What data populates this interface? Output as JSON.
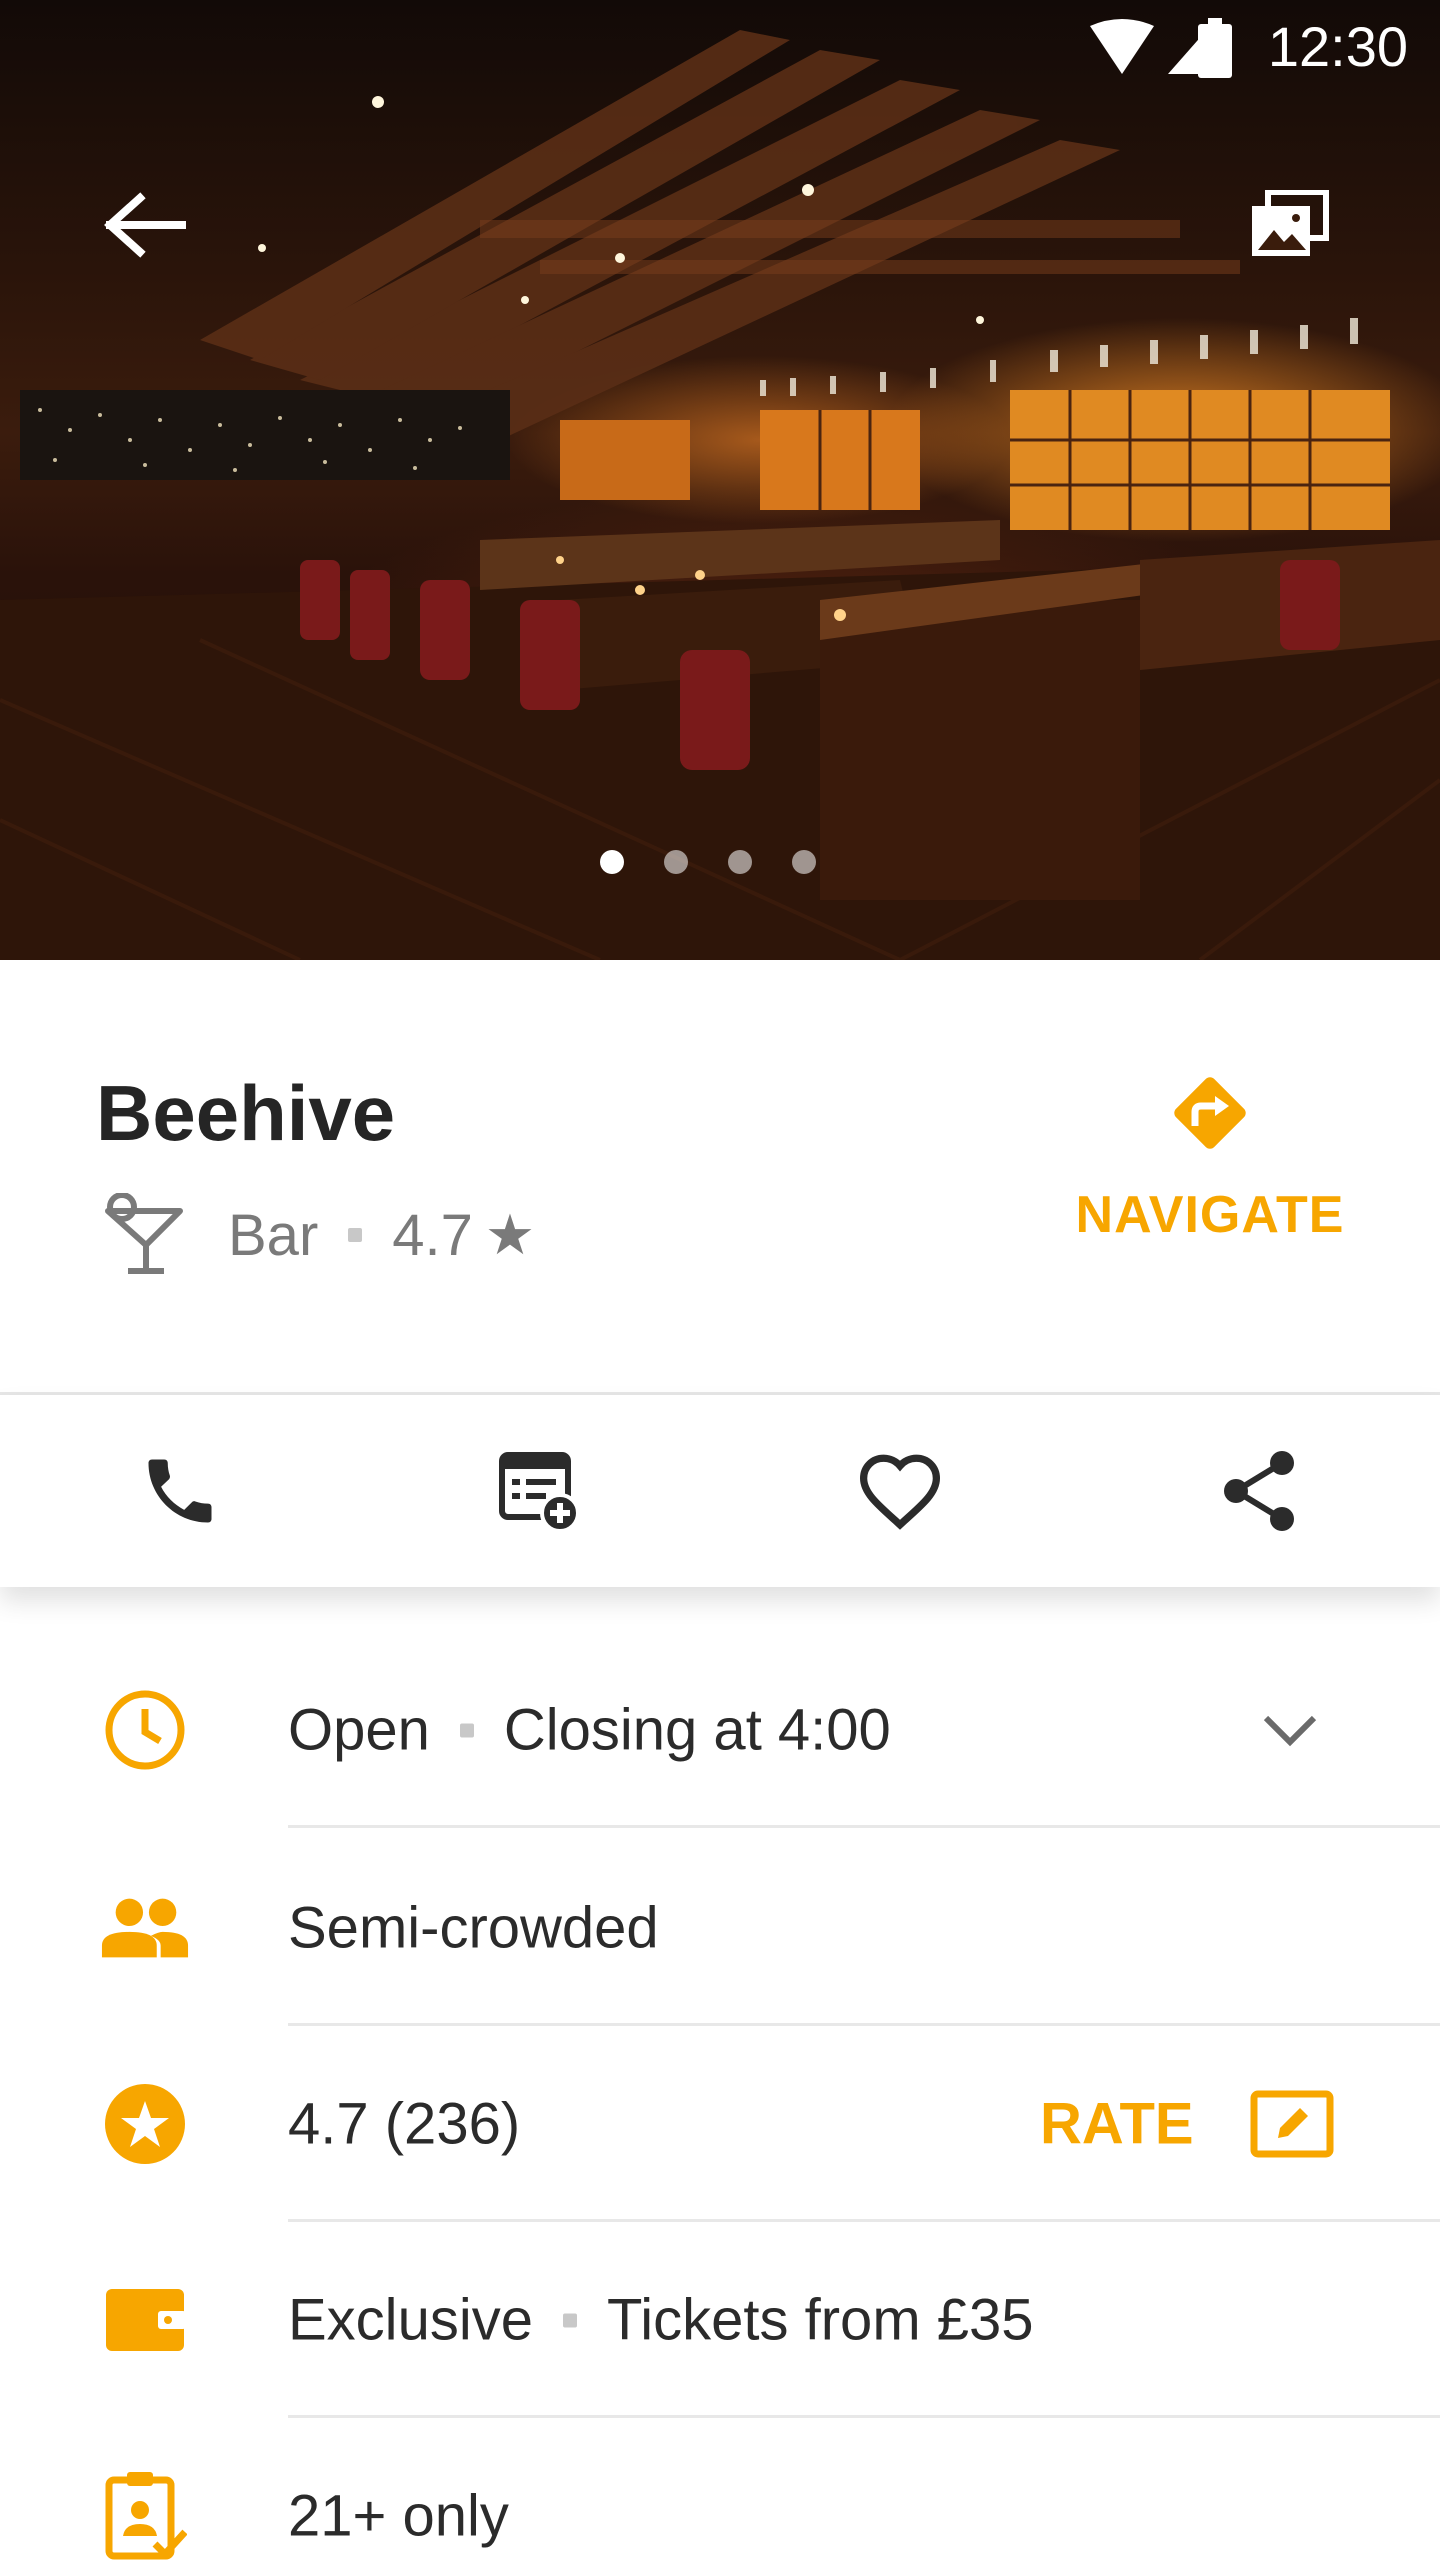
{
  "status_bar": {
    "time": "12:30"
  },
  "hero": {
    "image_count": 4,
    "active_index": 0
  },
  "place": {
    "name": "Beehive",
    "category": "Bar",
    "rating": "4.7",
    "navigate_label": "NAVIGATE"
  },
  "actions": [
    "call-icon",
    "calendar-add-icon",
    "heart-icon",
    "share-icon"
  ],
  "info": {
    "hours": {
      "status": "Open",
      "detail": "Closing at 4:00"
    },
    "crowd": "Semi-crowded",
    "rating": {
      "text": "4.7 (236)",
      "rate_label": "RATE"
    },
    "price": {
      "tier": "Exclusive",
      "tickets": "Tickets from £35"
    },
    "age": "21+ only"
  },
  "colors": {
    "accent": "#f7a600",
    "text": "#2b2b2b",
    "muted": "#7a7a7a"
  }
}
